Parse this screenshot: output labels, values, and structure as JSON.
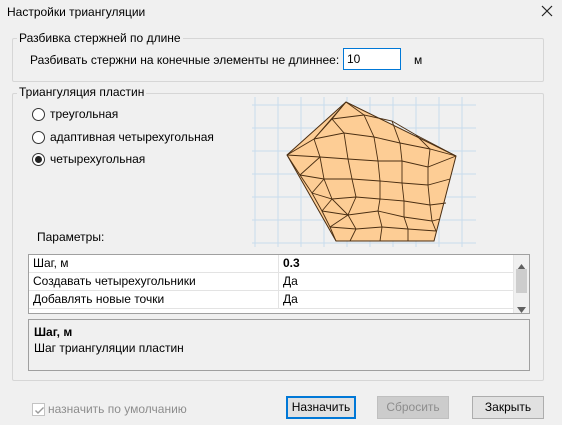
{
  "window": {
    "title": "Настройки триангуляции"
  },
  "rods_group": {
    "title": "Разбивка стержней по длине",
    "label": "Разбивать стержни на конечные элементы не длиннее:",
    "value": "10",
    "unit": "м"
  },
  "plates_group": {
    "title": "Триангуляция пластин",
    "options": [
      {
        "label": "треугольная",
        "checked": false
      },
      {
        "label": "адаптивная четырехугольная",
        "checked": false
      },
      {
        "label": "четырехугольная",
        "checked": true
      }
    ],
    "params_label": "Параметры:",
    "params": [
      {
        "name": "Шаг, м",
        "value": "0.3",
        "bold": true
      },
      {
        "name": "Создавать четырехугольники",
        "value": "Да"
      },
      {
        "name": "Добавлять новые точки",
        "value": "Да"
      }
    ],
    "description": {
      "title": "Шаг, м",
      "text": "Шаг триангуляции пластин"
    }
  },
  "footer": {
    "default_checkbox_label": "назначить по умолчанию",
    "default_checked": true,
    "assign_label": "Назначить",
    "reset_label": "Сбросить",
    "close_label": "Закрыть"
  },
  "colors": {
    "mesh_fill": "#fdcd95",
    "mesh_stroke": "#4a2e12",
    "grid_line": "#c8dced",
    "accent": "#0078d7"
  },
  "icons": {
    "close": "close-icon",
    "scroll_up": "chevron-up-icon",
    "scroll_down": "chevron-down-icon",
    "check": "checkmark-icon"
  }
}
